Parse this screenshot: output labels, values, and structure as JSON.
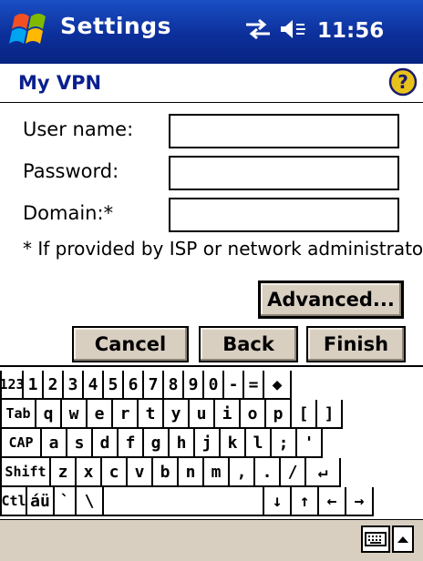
{
  "title_bar": {
    "app_title": "Settings",
    "time": "11:56",
    "icons": [
      "windows-start-icon",
      "connectivity-icon",
      "speaker-icon"
    ]
  },
  "header": {
    "page_title": "My VPN",
    "help_icon": "help-icon"
  },
  "form": {
    "username_label": "User name:",
    "username_value": "",
    "password_label": "Password:",
    "password_value": "",
    "domain_label": "Domain:*",
    "domain_value": "",
    "note": "* If provided by ISP or network administrator."
  },
  "buttons": {
    "advanced": "Advanced...",
    "cancel": "Cancel",
    "back": "Back",
    "finish": "Finish"
  },
  "keyboard": {
    "row1": [
      "123",
      "1",
      "2",
      "3",
      "4",
      "5",
      "6",
      "7",
      "8",
      "9",
      "0",
      "-",
      "=",
      "◆"
    ],
    "row2": [
      "Tab",
      "q",
      "w",
      "e",
      "r",
      "t",
      "y",
      "u",
      "i",
      "o",
      "p",
      "[",
      "]"
    ],
    "row3": [
      "CAP",
      "a",
      "s",
      "d",
      "f",
      "g",
      "h",
      "j",
      "k",
      "l",
      ";",
      "'"
    ],
    "row4": [
      "Shift",
      "z",
      "x",
      "c",
      "v",
      "b",
      "n",
      "m",
      ",",
      ".",
      "/",
      "↵"
    ],
    "row5": [
      "Ctl",
      "áü",
      "`",
      "\\",
      "",
      "↓",
      "↑",
      "←",
      "→"
    ]
  },
  "colors": {
    "title_bar": "#0c2f9a",
    "page_title": "#0a1f8f",
    "button_face": "#d8cfc1",
    "help_icon": "#e8c21a"
  }
}
